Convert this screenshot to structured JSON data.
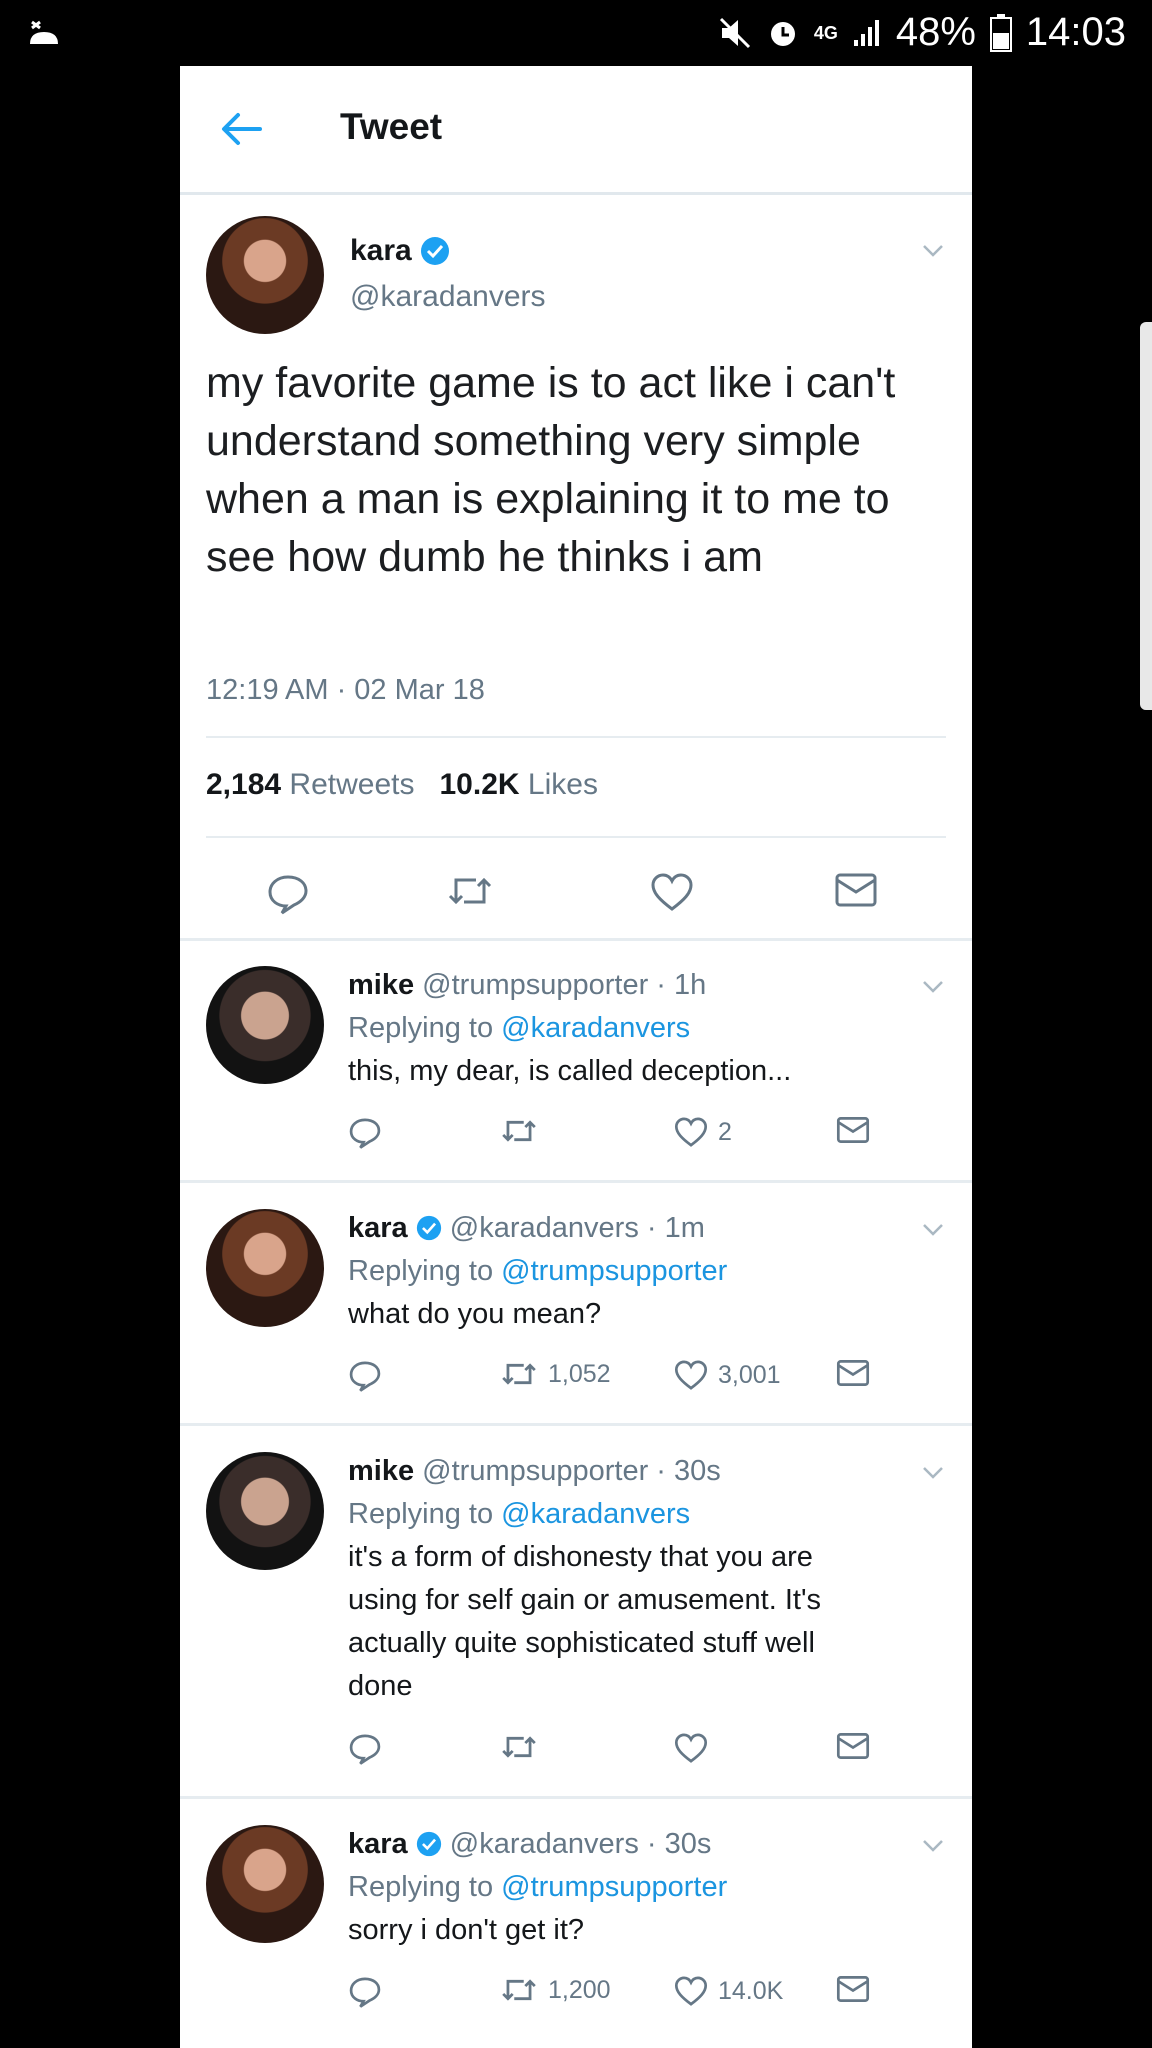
{
  "status_bar": {
    "left_icon": "notification-icon",
    "network": "4G",
    "battery": "48%",
    "time": "14:03",
    "icons": [
      "mute-icon",
      "alarm-icon",
      "signal-icon",
      "battery-icon"
    ]
  },
  "header": {
    "title": "Tweet",
    "back_icon": "back-arrow-icon"
  },
  "tweet": {
    "name": "kara",
    "handle": "@karadanvers",
    "text": "my favorite game is to act like i can't understand something very simple when a man is explaining it to me to see how dumb he thinks i am",
    "timestamp": "12:19 AM · 02 Mar 18",
    "retweet_count": "2,184",
    "retweet_label": "Retweets",
    "like_count": "10.2K",
    "like_label": "Likes"
  },
  "replies": [
    {
      "name": "mike",
      "meta": "@trumpsupporter · 1h",
      "replying_prefix": "Replying to",
      "replying_to": "@karadanvers",
      "text": "this, my dear, is called deception...",
      "retweets": "",
      "likes": "2"
    },
    {
      "name": "kara",
      "verified": true,
      "meta": "@karadanvers · 1m",
      "replying_prefix": "Replying to",
      "replying_to": "@trumpsupporter",
      "text": "what do you mean?",
      "retweets": "1,052",
      "likes": "3,001"
    },
    {
      "name": "mike",
      "meta": "@trumpsupporter · 30s",
      "replying_prefix": "Replying to",
      "replying_to": "@karadanvers",
      "text_lines": [
        "it's a form of dishonesty that you are",
        "using for self gain or amusement. It's",
        "actually quite sophisticated stuff well",
        "done"
      ],
      "retweets": "",
      "likes": ""
    },
    {
      "name": "kara",
      "verified": true,
      "meta": "@karadanvers · 30s",
      "replying_prefix": "Replying to",
      "replying_to": "@trumpsupporter",
      "text": "sorry i don't get it?",
      "retweets": "1,200",
      "likes": "14.0K"
    }
  ],
  "colors": {
    "link": "#1b95e0",
    "muted": "#657786",
    "divider": "#e6ecf0"
  }
}
